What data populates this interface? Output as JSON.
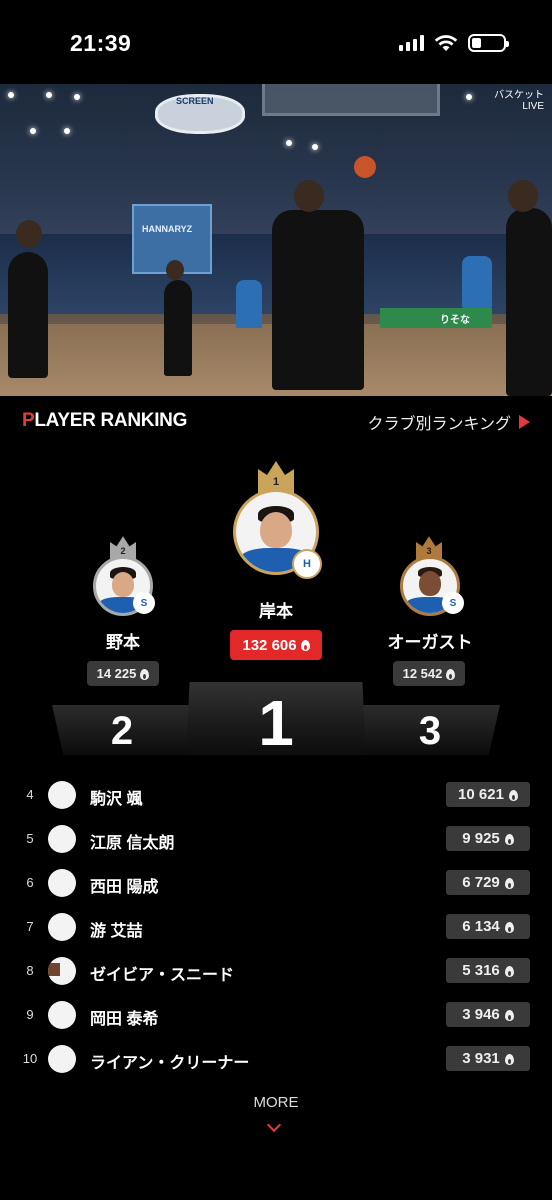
{
  "status_bar": {
    "time": "21:39",
    "battery_level": 0.3
  },
  "video": {
    "broadcaster_logo": [
      "バスケット",
      "LIVE"
    ],
    "banner_text": "HANNARYZ",
    "scoreboard_text": "SCREEN",
    "ad_text": "りそな"
  },
  "header": {
    "title_first_letter": "P",
    "title_rest": "LAYER RANKING",
    "club_ranking_link": "クラブ別ランキング"
  },
  "podium": {
    "first": {
      "rank": "1",
      "name": "岸本",
      "points": "132 606",
      "team_badge": "H"
    },
    "second": {
      "rank": "2",
      "name": "野本",
      "points": "14 225",
      "team_badge": "S"
    },
    "third": {
      "rank": "3",
      "name": "オーガスト",
      "points": "12 542",
      "team_badge": "S"
    },
    "steps": {
      "left": "2",
      "center": "1",
      "right": "3"
    }
  },
  "ranking_list": [
    {
      "rank": "4",
      "name": "駒沢 颯",
      "points": "10 621"
    },
    {
      "rank": "5",
      "name": "江原 信太朗",
      "points": "9 925"
    },
    {
      "rank": "6",
      "name": "西田 陽成",
      "points": "6 729"
    },
    {
      "rank": "7",
      "name": "游 艾喆",
      "points": "6 134"
    },
    {
      "rank": "8",
      "name": "ゼイビア・スニード",
      "points": "5 316"
    },
    {
      "rank": "9",
      "name": "岡田 泰希",
      "points": "3 946"
    },
    {
      "rank": "10",
      "name": "ライアン・クリーナー",
      "points": "3 931"
    }
  ],
  "more_label": "MORE",
  "colors": {
    "accent_red": "#e22828",
    "gold": "#c9a45a",
    "silver": "#a8a8a8",
    "bronze": "#b07a3e",
    "pill_bg": "#3a3a3a"
  }
}
